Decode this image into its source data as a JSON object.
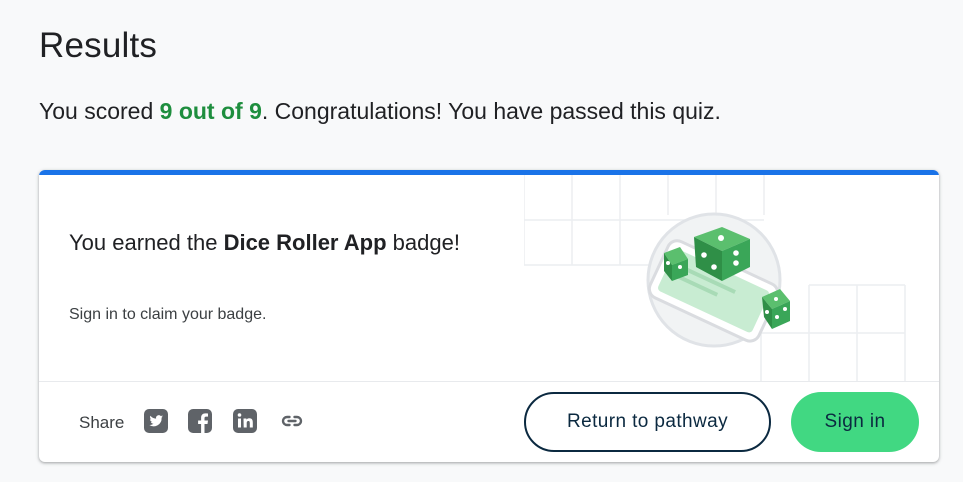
{
  "page": {
    "title": "Results",
    "score_prefix": "You scored ",
    "score_value": "9 out of 9",
    "score_suffix": ". Congratulations! You have passed this quiz."
  },
  "badge_card": {
    "earned_prefix": "You earned the ",
    "badge_name": "Dice Roller App",
    "earned_suffix": " badge!",
    "claim_text": "Sign in to claim your badge.",
    "accent_color": "#1a73e8"
  },
  "share": {
    "label": "Share",
    "icons": [
      "twitter-icon",
      "facebook-icon",
      "linkedin-icon",
      "link-icon"
    ]
  },
  "actions": {
    "return_label": "Return to pathway",
    "signin_label": "Sign in",
    "signin_color": "#41d882"
  },
  "colors": {
    "score_green": "#1e8e3e",
    "dice_green": "#34a853"
  }
}
